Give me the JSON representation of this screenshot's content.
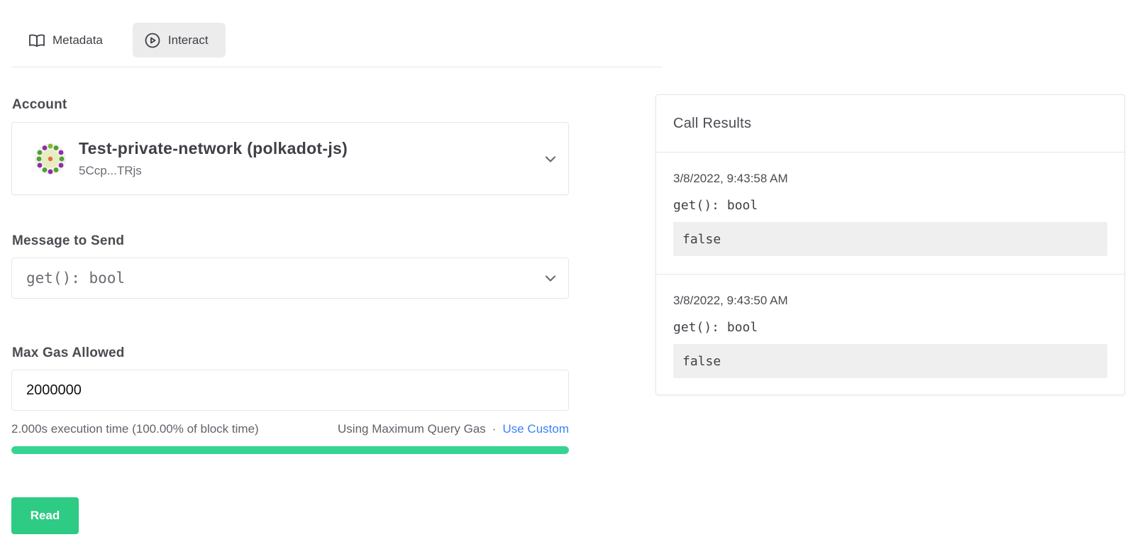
{
  "tabs": [
    {
      "label": "Metadata",
      "icon": "book-open-icon",
      "active": false
    },
    {
      "label": "Interact",
      "icon": "play-circle-icon",
      "active": true
    }
  ],
  "account": {
    "label": "Account",
    "name": "Test-private-network (polkadot-js)",
    "address": "5Ccp...TRjs"
  },
  "message": {
    "label": "Message to Send",
    "value": "get(): bool"
  },
  "gas": {
    "label": "Max Gas Allowed",
    "value": "2000000",
    "execution_text": "2.000s execution time (100.00% of block time)",
    "mode_text": "Using Maximum Query Gas",
    "separator": "·",
    "custom_link": "Use Custom",
    "progress": 1.0,
    "progress_color": "#36d492"
  },
  "read_button": "Read",
  "results": {
    "title": "Call Results",
    "items": [
      {
        "time": "3/8/2022, 9:43:58 AM",
        "signature": "get(): bool",
        "output": "false"
      },
      {
        "time": "3/8/2022, 9:43:50 AM",
        "signature": "get(): bool",
        "output": "false"
      }
    ]
  },
  "colors": {
    "accent_green": "#2ecb84",
    "link_blue": "#3b82f6"
  }
}
